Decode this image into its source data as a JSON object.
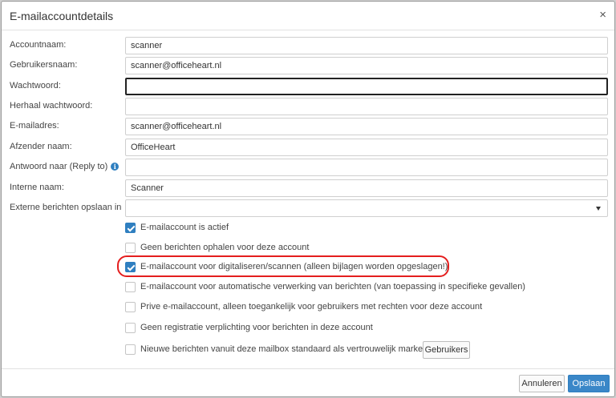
{
  "dialog": {
    "title": "E-mailaccountdetails",
    "close_label": "×"
  },
  "form": {
    "accountnaam": {
      "label": "Accountnaam:",
      "value": "scanner"
    },
    "gebruikersnaam": {
      "label": "Gebruikersnaam:",
      "value": "scanner@officeheart.nl"
    },
    "wachtwoord": {
      "label": "Wachtwoord:",
      "value": ""
    },
    "herhaal": {
      "label": "Herhaal wachtwoord:",
      "value": ""
    },
    "emailadres": {
      "label": "E-mailadres:",
      "value": "scanner@officeheart.nl"
    },
    "afzender": {
      "label": "Afzender naam:",
      "value": "OfficeHeart"
    },
    "antwoord": {
      "label": "Antwoord naar (Reply to)",
      "value": "",
      "info_icon": "info-icon",
      "info_glyph": "i"
    },
    "interne": {
      "label": "Interne naam:",
      "value": "Scanner"
    },
    "extern_opslaan": {
      "label": "Externe berichten opslaan in",
      "value": ""
    }
  },
  "checkboxes": [
    {
      "label": "E-mailaccount is actief",
      "checked": true
    },
    {
      "label": "Geen berichten ophalen voor deze account",
      "checked": false
    },
    {
      "label": "E-mailaccount voor digitaliseren/scannen (alleen bijlagen worden opgeslagen!)",
      "checked": true
    },
    {
      "label": "E-mailaccount voor automatische verwerking van berichten (van toepassing in specifieke gevallen)",
      "checked": false
    },
    {
      "label": "Prive e-mailaccount, alleen toegankelijk voor gebruikers met rechten voor deze account",
      "checked": false
    },
    {
      "label": "Geen registratie verplichting voor berichten in deze account",
      "checked": false
    },
    {
      "label": "Nieuwe berichten vanuit deze mailbox standaard als vertrouwelijk markeren",
      "checked": false
    }
  ],
  "users_button": "Gebruikers",
  "footer": {
    "cancel_label": "Annuleren",
    "save_label": "Opslaan"
  },
  "colors": {
    "accent": "#2f7fc0",
    "highlight": "#e41e1e"
  }
}
